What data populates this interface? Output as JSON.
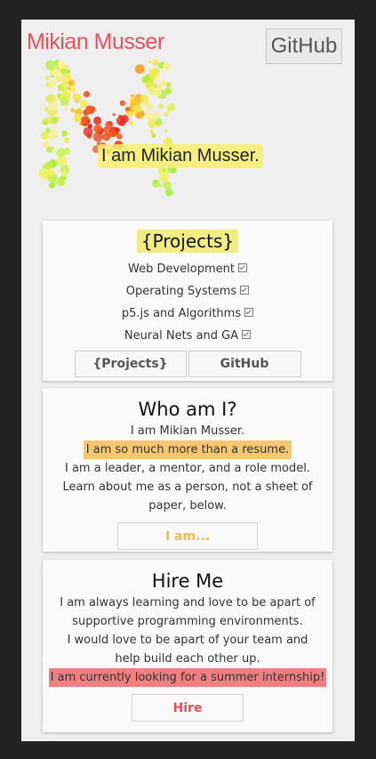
{
  "header": {
    "brand": "Mikian Musser",
    "github_button": "GitHub",
    "tagline": "I am Mikian Musser."
  },
  "projects_card": {
    "title": "{Projects}",
    "items": [
      {
        "label": "Web Development"
      },
      {
        "label": "Operating Systems"
      },
      {
        "label": "p5.js and Algorithms"
      },
      {
        "label": "Neural Nets and GA"
      }
    ],
    "buttons": {
      "projects": "{Projects}",
      "github": "GitHub"
    }
  },
  "about_card": {
    "title": "Who am I?",
    "line1": "I am Mikian Musser.",
    "highlight": "I am so much more than a resume.",
    "line3": "I am a leader, a mentor, and a role model.",
    "line4": "Learn about me as a person, not a sheet of paper, below.",
    "button": "I am..."
  },
  "hire_card": {
    "title": "Hire Me",
    "line1": "I am always learning and love to be apart of supportive programming environments.",
    "line2": "I would love to be apart of your team and help build each other up.",
    "highlight": "I am currently looking for a summer internship!",
    "button": "Hire"
  },
  "colors": {
    "brand": "#e8505b",
    "yellow_highlight": "#f3ec82",
    "orange_highlight": "#f5c870",
    "red_highlight": "#f07f81",
    "frame": "#232323"
  },
  "icons": [
    "checkbox-icon",
    "m-dot-logo"
  ]
}
